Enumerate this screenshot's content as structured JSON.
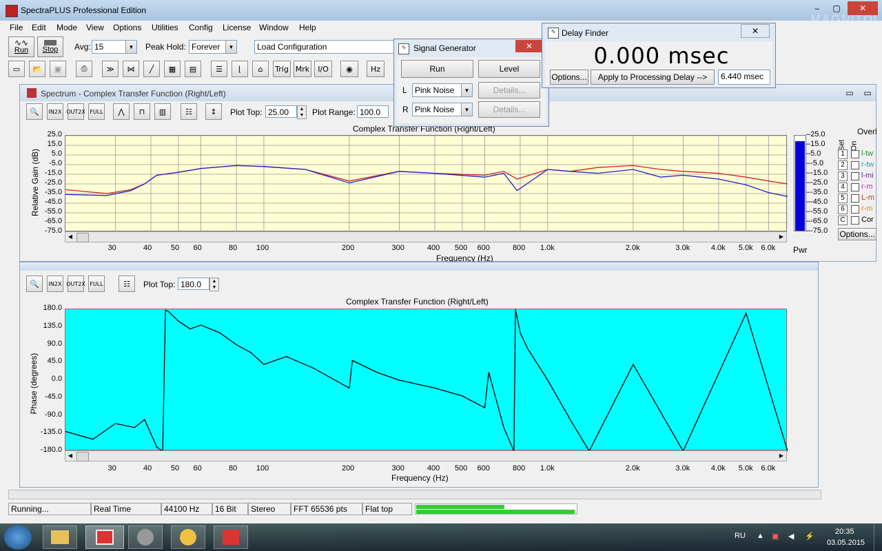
{
  "app": {
    "title": "SpectraPLUS Professional Edition",
    "watermark_logo": "MAGNITOLA"
  },
  "menu": [
    "File",
    "Edit",
    "Mode",
    "View",
    "Options",
    "Utilities",
    "Config",
    "License",
    "Window",
    "Help"
  ],
  "toolbar": {
    "run_label": "Run",
    "stop_label": "Stop",
    "avg_label": "Avg:",
    "avg_value": "15",
    "peak_label": "Peak Hold:",
    "peak_value": "Forever",
    "config_value": "Load Configuration",
    "icons": [
      "Trig",
      "Mrk",
      "I/O",
      "Hz"
    ]
  },
  "spectrum": {
    "title": "Spectrum - Complex Transfer Function (Right/Left)",
    "plot_top_label": "Plot Top:",
    "plot_top_value": "25.00",
    "plot_range_label": "Plot Range:",
    "plot_range_value": "100.0",
    "pwr_label": "Pwr",
    "overlay_header": "Overl",
    "set_label": "Set",
    "on_label": "On",
    "overlays": [
      {
        "num": "1",
        "name": "l-tw",
        "color": "#2a8a2a"
      },
      {
        "num": "2",
        "name": "r-tw",
        "color": "#2aa0a0"
      },
      {
        "num": "3",
        "name": "l-mi",
        "color": "#6a2a8a"
      },
      {
        "num": "4",
        "name": "r-m",
        "color": "#d020d0"
      },
      {
        "num": "5",
        "name": "L-m",
        "color": "#b04020"
      },
      {
        "num": "6",
        "name": "r-m",
        "color": "#e08020"
      },
      {
        "num": "C",
        "name": "Cor",
        "color": "#000000"
      }
    ],
    "options_label": "Options..."
  },
  "phase": {
    "plot_top_label": "Plot Top:",
    "plot_top_value": "180.0"
  },
  "signal_generator": {
    "title": "Signal Generator",
    "run_label": "Run",
    "level_label": "Level",
    "l_label": "L",
    "r_label": "R",
    "l_value": "Pink Noise",
    "r_value": "Pink Noise",
    "details_label": "Details..."
  },
  "delay_finder": {
    "title": "Delay Finder",
    "value": "0.000 msec",
    "options_label": "Options...",
    "apply_label": "Apply to Processing Delay -->",
    "delay_value": "6.440 msec"
  },
  "status": {
    "running": "Running...",
    "mode": "Real Time",
    "rate": "44100 Hz",
    "bits": "16 Bit",
    "channels": "Stereo",
    "fft": "FFT 65536 pts",
    "window": "Flat top",
    "meter_left": 0.55,
    "meter_right": 0.99
  },
  "taskbar": {
    "lang": "RU",
    "time": "20:35",
    "date": "03.05.2015"
  },
  "chart_data": [
    {
      "type": "line",
      "title": "Complex Transfer Function (Right/Left)",
      "xlabel": "Frequency (Hz)",
      "ylabel": "Relative Gain (dB)",
      "xscale": "log",
      "xlim": [
        20,
        7000
      ],
      "ylim": [
        -75,
        25
      ],
      "x_ticks": [
        "30",
        "40",
        "50",
        "60",
        "80",
        "100",
        "200",
        "300",
        "400",
        "500",
        "600",
        "800",
        "1.0k",
        "2.0k",
        "3.0k",
        "4.0k",
        "5.0k",
        "6.0k"
      ],
      "y_ticks": [
        "25.0",
        "15.0",
        "5.0",
        "-5.0",
        "-15.0",
        "-25.0",
        "-35.0",
        "-45.0",
        "-55.0",
        "-65.0",
        "-75.0"
      ],
      "pwr_ticks": [
        "25.0",
        "15.0",
        "5.0",
        "-5.0",
        "-15.0",
        "-25.0",
        "-35.0",
        "-45.0",
        "-55.0",
        "-65.0",
        "-75.0"
      ],
      "grid": true,
      "series": [
        {
          "color": "#d02020",
          "x": [
            20,
            28,
            34,
            38,
            42,
            50,
            60,
            80,
            100,
            140,
            200,
            300,
            400,
            600,
            700,
            780,
            1000,
            1200,
            1500,
            2000,
            2500,
            3000,
            4000,
            5000,
            6000,
            7000
          ],
          "y": [
            -31,
            -35,
            -31,
            -25,
            -16,
            -13,
            -9,
            -6,
            -7,
            -10,
            -22,
            -12,
            -14,
            -16,
            -12,
            -20,
            -10,
            -12,
            -8,
            -6,
            -10,
            -12,
            -14,
            -18,
            -22,
            -25
          ]
        },
        {
          "color": "#2020c0",
          "x": [
            20,
            28,
            34,
            38,
            42,
            50,
            60,
            80,
            100,
            140,
            200,
            300,
            400,
            600,
            700,
            780,
            1000,
            1200,
            1500,
            2000,
            2500,
            3000,
            4000,
            5000,
            6000,
            7000
          ],
          "y": [
            -36,
            -37,
            -32,
            -25,
            -16,
            -13,
            -9,
            -6,
            -7,
            -10,
            -24,
            -12,
            -14,
            -18,
            -14,
            -32,
            -10,
            -12,
            -14,
            -10,
            -18,
            -16,
            -20,
            -26,
            -34,
            -38
          ]
        }
      ]
    },
    {
      "type": "line",
      "title": "Complex Transfer Function (Right/Left)",
      "xlabel": "Frequency (Hz)",
      "ylabel": "Phase (degrees)",
      "xscale": "log",
      "xlim": [
        20,
        7000
      ],
      "ylim": [
        -180,
        180
      ],
      "x_ticks": [
        "30",
        "40",
        "50",
        "60",
        "80",
        "100",
        "200",
        "300",
        "400",
        "500",
        "600",
        "800",
        "1.0k",
        "2.0k",
        "3.0k",
        "4.0k",
        "5.0k",
        "6.0k"
      ],
      "y_ticks": [
        "180.0",
        "135.0",
        "90.0",
        "45.0",
        "0.0",
        "-45.0",
        "-90.0",
        "-135.0",
        "-180.0"
      ],
      "grid": false,
      "series": [
        {
          "color": "#000000",
          "x": [
            20,
            25,
            30,
            35,
            38,
            42,
            44,
            45,
            46,
            50,
            55,
            60,
            70,
            80,
            90,
            100,
            120,
            150,
            200,
            205,
            250,
            300,
            400,
            500,
            600,
            620,
            700,
            760,
            770,
            800,
            850,
            1000,
            1200,
            1400,
            2000,
            3000,
            5000,
            7000
          ],
          "y": [
            -130,
            -150,
            -110,
            -120,
            -100,
            -170,
            -180,
            178,
            175,
            150,
            130,
            140,
            120,
            90,
            70,
            40,
            60,
            30,
            -20,
            50,
            20,
            0,
            -20,
            -40,
            -70,
            20,
            -120,
            -180,
            180,
            120,
            80,
            0,
            -100,
            -180,
            40,
            -180,
            170,
            -180
          ]
        }
      ]
    }
  ]
}
